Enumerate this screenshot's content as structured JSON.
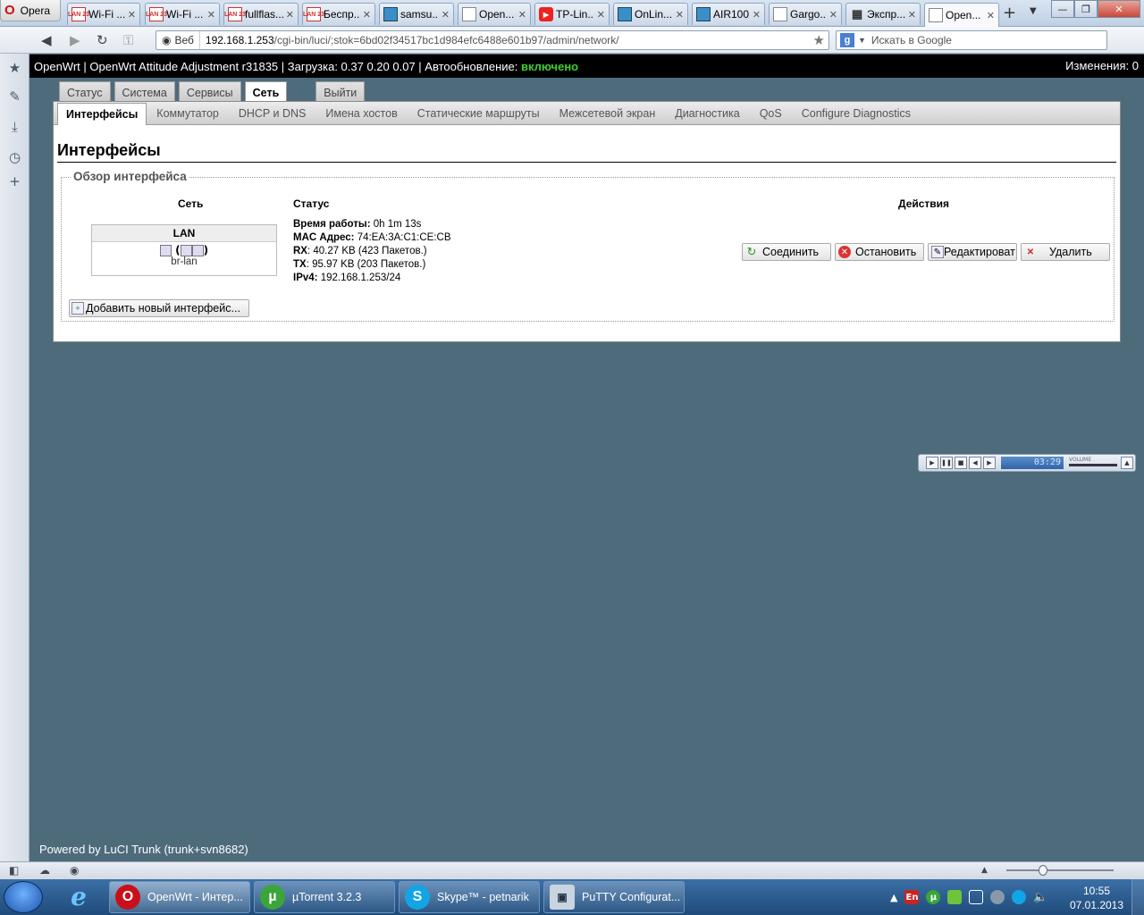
{
  "browser": {
    "menu_label": "Opera",
    "tabs": [
      {
        "title": "Wi-Fi ...",
        "icon": "lan-icon"
      },
      {
        "title": "Wi-Fi ...",
        "icon": "lan-icon"
      },
      {
        "title": "fullflas...",
        "icon": "lan-icon"
      },
      {
        "title": "Беспр...",
        "icon": "lan-icon"
      },
      {
        "title": "samsu...",
        "icon": "site-icon"
      },
      {
        "title": "Open...",
        "icon": "page-icon"
      },
      {
        "title": "TP-Lin...",
        "icon": "youtube-icon"
      },
      {
        "title": "OnLin...",
        "icon": "image-icon"
      },
      {
        "title": "AIR100...",
        "icon": "site-icon"
      },
      {
        "title": "Gargo...",
        "icon": "page-icon"
      },
      {
        "title": "Экспр...",
        "icon": "grid-icon"
      },
      {
        "title": "Open...",
        "icon": "page-icon",
        "active": true
      }
    ],
    "address": {
      "web_label": "Веб",
      "host": "192.168.1.253",
      "path": "/cgi-bin/luci/;stok=6bd02f34517bc1d984efc6488e601b97/admin/network/"
    },
    "search_placeholder": "Искать в Google"
  },
  "luci": {
    "status_prefix": "OpenWrt | OpenWrt Attitude Adjustment r31835 | Загрузка: 0.37 0.20 0.07 | Автообновление: ",
    "autorefresh_value": "включено",
    "changes": "Изменения: 0",
    "main_tabs": [
      "Статус",
      "Система",
      "Сервисы",
      "Сеть",
      "Выйти"
    ],
    "sub_tabs": [
      "Интерфейсы",
      "Коммутатор",
      "DHCP и DNS",
      "Имена хостов",
      "Статические маршруты",
      "Межсетевой экран",
      "Диагностика",
      "QoS",
      "Configure Diagnostics"
    ],
    "page_title": "Интерфейсы",
    "section_title": "Обзор интерфейса",
    "columns": {
      "network": "Сеть",
      "status": "Статус",
      "actions": "Действия"
    },
    "interface": {
      "name": "LAN",
      "device": "br-lan",
      "status": [
        {
          "label": "Время работы:",
          "value": "0h 1m 13s"
        },
        {
          "label": "MAC Адрес:",
          "value": "74:EA:3A:C1:CE:CB"
        },
        {
          "label": "RX",
          "value": ": 40.27 KB (423 Пакетов.)"
        },
        {
          "label": "TX",
          "value": ": 95.97 KB (203 Пакетов.)"
        },
        {
          "label": "IPv4:",
          "value": "192.168.1.253/24"
        }
      ]
    },
    "actions": [
      "Соединить",
      "Остановить",
      "Редактироват",
      "Удалить"
    ],
    "add_interface": "Добавить новый интерфейс...",
    "footer": "Powered by LuCI Trunk (trunk+svn8682)"
  },
  "player": {
    "time": "03:29",
    "volume_label": "VOLUME"
  },
  "taskbar": {
    "items": [
      {
        "label": "OpenWrt - Интер...",
        "active": true
      },
      {
        "label": "µTorrent 3.2.3"
      },
      {
        "label": "Skype™ - petnarik"
      },
      {
        "label": "PuTTY Configurat..."
      }
    ],
    "lang": "En",
    "time": "10:55",
    "date": "07.01.2013"
  },
  "colors": {
    "page_bg": "#4e6b7c",
    "status_on": "#3ecf2e",
    "status_bar": "#000000"
  }
}
